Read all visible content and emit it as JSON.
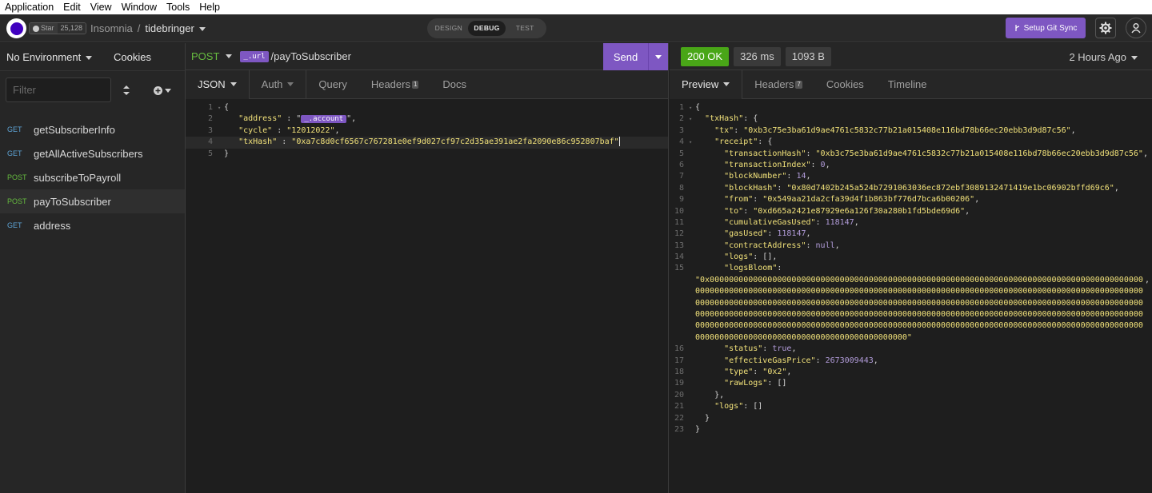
{
  "menu": [
    "Application",
    "Edit",
    "View",
    "Window",
    "Tools",
    "Help"
  ],
  "header": {
    "star_label": "Star",
    "star_count": "25,128",
    "breadcrumb_root": "Insomnia",
    "breadcrumb_sep": "/",
    "project": "tidebringer",
    "modes": [
      "DESIGN",
      "DEBUG",
      "TEST"
    ],
    "active_mode": "DEBUG",
    "git_sync_label": "Setup Git Sync"
  },
  "sidebar": {
    "environment": "No Environment",
    "cookies": "Cookies",
    "filter_placeholder": "Filter",
    "requests": [
      {
        "method": "GET",
        "name": "getSubscriberInfo"
      },
      {
        "method": "GET",
        "name": "getAllActiveSubscribers"
      },
      {
        "method": "POST",
        "name": "subscribeToPayroll"
      },
      {
        "method": "POST",
        "name": "payToSubscriber"
      },
      {
        "method": "GET",
        "name": "address"
      }
    ],
    "active_index": 3
  },
  "request": {
    "method": "POST",
    "url_var": "_.url",
    "url_path": "/payToSubscriber",
    "send_label": "Send",
    "tabs": {
      "json": "JSON",
      "auth": "Auth",
      "query": "Query",
      "headers": "Headers",
      "headers_count": "1",
      "docs": "Docs"
    },
    "body": {
      "address_key": "\"address\"",
      "address_var": "_.account",
      "cycle_key": "\"cycle\"",
      "cycle_val": "\"12012022\"",
      "txhash_key": "\"txHash\"",
      "txhash_val": "\"0xa7c8d0cf6567c767281e0ef9d027cf97c2d35ae391ae2fa2090e86c952807baf\""
    }
  },
  "response": {
    "status": "200 OK",
    "time": "326 ms",
    "size": "1093 B",
    "age": "2 Hours Ago",
    "tabs": {
      "preview": "Preview",
      "headers": "Headers",
      "headers_count": "7",
      "cookies": "Cookies",
      "timeline": "Timeline"
    },
    "body": {
      "tx": "\"0xb3c75e3ba61d9ae4761c5832c77b21a015408e116bd78b66ec20ebb3d9d87c56\"",
      "transactionHash": "\"0xb3c75e3ba61d9ae4761c5832c77b21a015408e116bd78b66ec20ebb3d9d87c56\"",
      "transactionIndex": "0",
      "blockNumber": "14",
      "blockHash": "\"0x80d7402b245a524b7291063036ec872ebf3089132471419e1bc06902bffd69c6\"",
      "from": "\"0x549aa21da2cfa39d4f1b863bf776d7bca6b00206\"",
      "to": "\"0xd665a2421e87929e6a126f30a280b1fd5bde69d6\"",
      "cumulativeGasUsed": "118147",
      "gasUsed": "118147",
      "contractAddress": "null",
      "logs_inner": "[]",
      "logsBloom": "\"0x00000000000000000000000000000000000000000000000000000000000000000000000000000000000000000000000000000000000000000000000000000000000000000000000000000000000000000000000000000000000000000000000000000000000000000000000000000000000000000000000000000000000000000000000000000000000000000000000000000000000000000000000000000000000000000000000000000000000000000000000000000000000000000000000000000000000000000000000000000000000000000000000000000000000000000000000000000000000000000000000000000000000000000000000000\"",
      "status": "true",
      "effectiveGasPrice": "2673009443",
      "type": "\"0x2\"",
      "rawLogs": "[]",
      "logs_outer": "[]"
    }
  }
}
